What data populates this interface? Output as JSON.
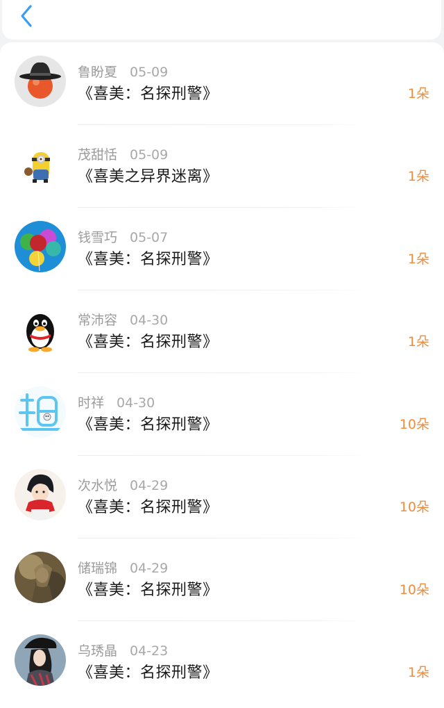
{
  "header": {
    "back_icon": "chevron-left-icon",
    "accent": "#3a9cf0"
  },
  "colors": {
    "amount": "#f08d3c",
    "name": "#9b9b9b",
    "title": "#1a1a1a"
  },
  "rows": [
    {
      "name": "鲁盼夏",
      "date": "05-09",
      "title": "《喜美：名探刑警》",
      "amount": "1朵",
      "avatar": "hat-orange-avatar"
    },
    {
      "name": "茂甜恬",
      "date": "05-09",
      "title": "《喜美之异界迷离》",
      "amount": "1朵",
      "avatar": "minion-avatar"
    },
    {
      "name": "钱雪巧",
      "date": "05-07",
      "title": "《喜美：名探刑警》",
      "amount": "1朵",
      "avatar": "balloons-avatar"
    },
    {
      "name": "常沛容",
      "date": "04-30",
      "title": "《喜美：名探刑警》",
      "amount": "1朵",
      "avatar": "penguin-avatar"
    },
    {
      "name": "时祥",
      "date": "04-30",
      "title": "《喜美：名探刑警》",
      "amount": "10朵",
      "avatar": "character-avatar"
    },
    {
      "name": "次水悦",
      "date": "04-29",
      "title": "《喜美：名探刑警》",
      "amount": "10朵",
      "avatar": "anime-avatar"
    },
    {
      "name": "储瑞锦",
      "date": "04-29",
      "title": "《喜美：名探刑警》",
      "amount": "10朵",
      "avatar": "painting-avatar"
    },
    {
      "name": "乌琇晶",
      "date": "04-23",
      "title": "《喜美：名探刑警》",
      "amount": "1朵",
      "avatar": "portrait-avatar"
    }
  ]
}
